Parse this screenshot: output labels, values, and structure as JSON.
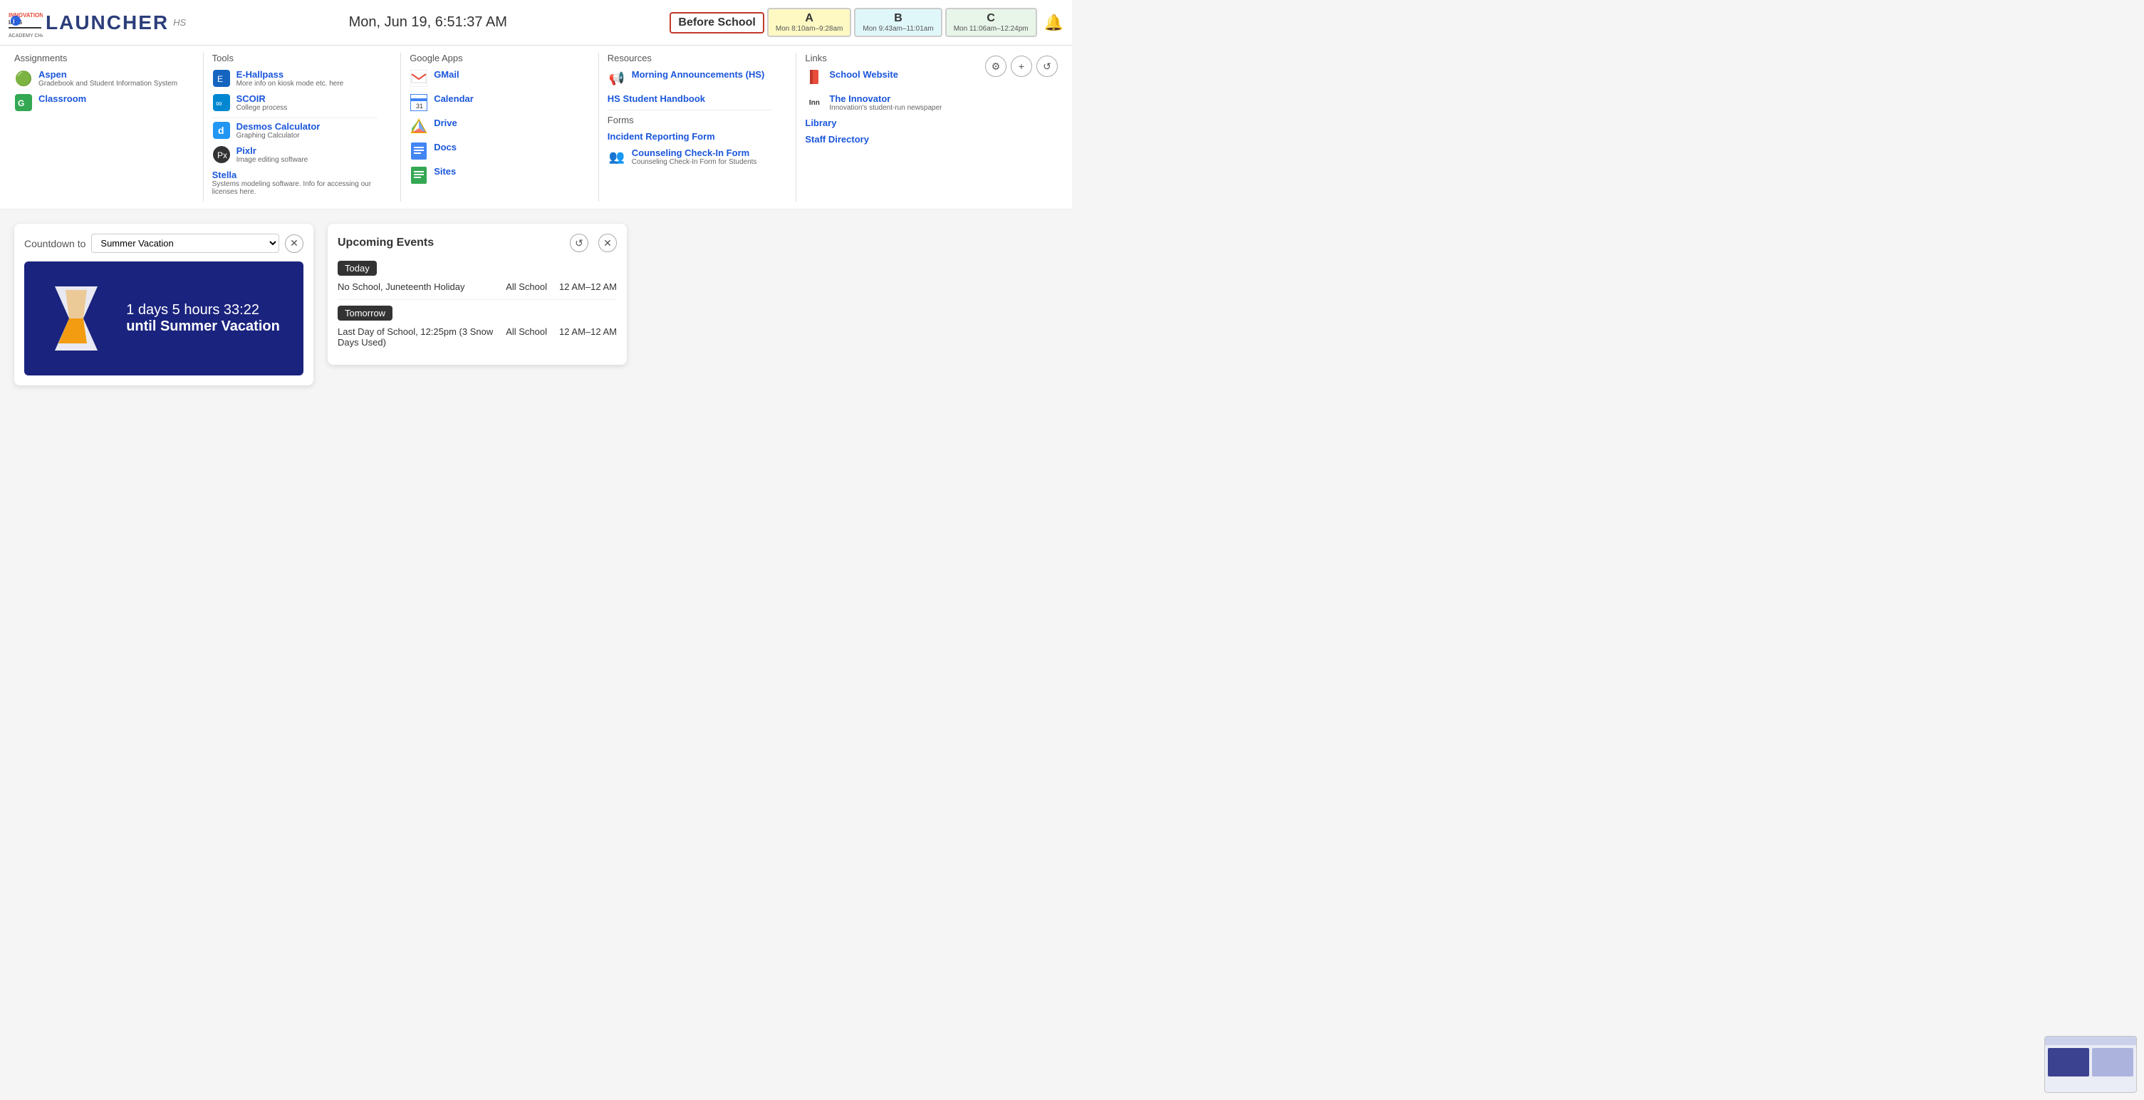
{
  "header": {
    "logo_text": "LAUNCHER",
    "hs_label": "HS",
    "clock": "Mon, Jun 19, 6:51:37 AM",
    "periods": [
      {
        "id": "before-school",
        "name": "Before School",
        "time": "",
        "style": "before-school"
      },
      {
        "id": "a",
        "name": "A",
        "time": "Mon  8:10am–9:28am",
        "style": "period-a"
      },
      {
        "id": "b",
        "name": "B",
        "time": "Mon  9:43am–11:01am",
        "style": "period-b"
      },
      {
        "id": "c",
        "name": "C",
        "time": "Mon  11:06am–12:24pm",
        "style": "period-c"
      }
    ]
  },
  "toolbar": {
    "settings_icon": "⚙",
    "add_icon": "+",
    "refresh_icon": "↺"
  },
  "assignments": {
    "title": "Assignments",
    "items": [
      {
        "name": "Aspen",
        "sub": "Gradebook and Student Information System",
        "icon": "🟢"
      },
      {
        "name": "Classroom",
        "sub": "",
        "icon": "🏫"
      }
    ]
  },
  "tools": {
    "title": "Tools",
    "items": [
      {
        "name": "E-Hallpass",
        "sub": "More info on kiosk mode etc. here",
        "icon": "🟦"
      },
      {
        "name": "SCOIR",
        "sub": "College process",
        "icon": "∞"
      },
      {
        "name": "Desmos Calculator",
        "sub": "Graphing Calculator",
        "icon": "d"
      },
      {
        "name": "Pixlr",
        "sub": "Image editing software",
        "icon": "🔵"
      },
      {
        "name": "Stella",
        "sub": "Systems modeling software. Info for accessing our licenses here.",
        "icon": ""
      }
    ]
  },
  "google_apps": {
    "title": "Google Apps",
    "items": [
      {
        "name": "GMail",
        "sub": "",
        "icon": "M"
      },
      {
        "name": "Calendar",
        "sub": "",
        "icon": "📅"
      },
      {
        "name": "Drive",
        "sub": "",
        "icon": "△"
      },
      {
        "name": "Docs",
        "sub": "",
        "icon": "📄"
      },
      {
        "name": "Sites",
        "sub": "",
        "icon": "📄"
      }
    ]
  },
  "resources": {
    "title": "Resources",
    "items": [
      {
        "name": "Morning Announcements (HS)",
        "sub": "",
        "icon": "📢"
      },
      {
        "name": "HS Student Handbook",
        "sub": "",
        "icon": ""
      }
    ],
    "forms_title": "Forms",
    "forms": [
      {
        "name": "Incident Reporting Form",
        "sub": "",
        "icon": ""
      },
      {
        "name": "Counseling Check-In Form",
        "sub": "Counseling Check-In Form for Students",
        "icon": "👥"
      }
    ]
  },
  "links": {
    "title": "Links",
    "items": [
      {
        "name": "School Website",
        "sub": "",
        "icon": "🔴"
      },
      {
        "name": "The Innovator",
        "sub": "Innovation's student-run newspaper",
        "icon": "Ιnn"
      },
      {
        "name": "Library",
        "sub": "",
        "icon": ""
      },
      {
        "name": "Staff Directory",
        "sub": "",
        "icon": ""
      }
    ]
  },
  "countdown": {
    "label": "Countdown to",
    "dropdown_value": "Summer Vacation",
    "dropdown_options": [
      "Summer Vacation"
    ],
    "display_days": "1 days 5 hours 33:22",
    "display_until_prefix": "until",
    "display_until_target": "Summer Vacation"
  },
  "events": {
    "title": "Upcoming Events",
    "today_badge": "Today",
    "tomorrow_badge": "Tomorrow",
    "today_events": [
      {
        "name": "No School, Juneteenth Holiday",
        "school": "All School",
        "time": "12 AM–12 AM"
      }
    ],
    "tomorrow_events": [
      {
        "name": "Last Day of School, 12:25pm (3 Snow Days Used)",
        "school": "All School",
        "time": "12 AM–12 AM"
      }
    ]
  }
}
